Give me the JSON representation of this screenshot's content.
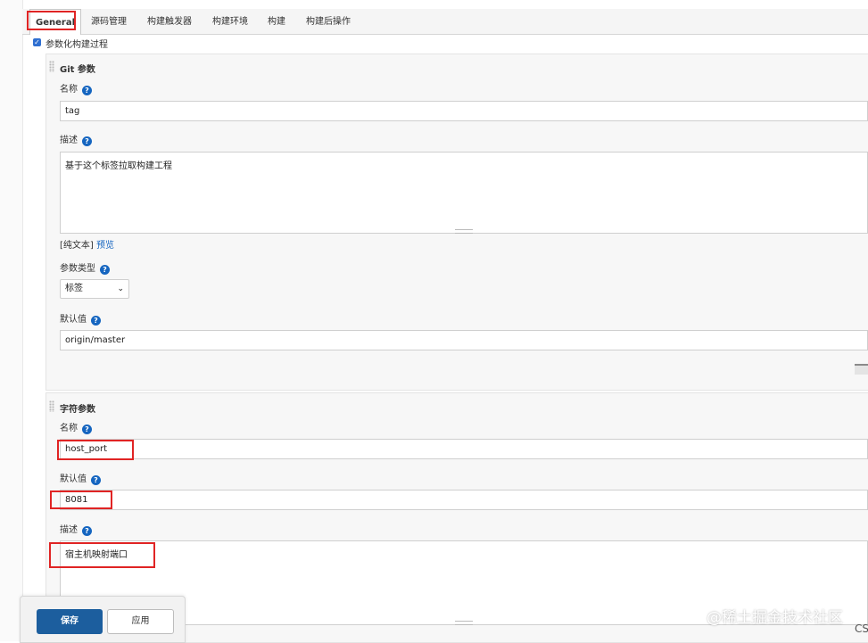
{
  "tabs": [
    {
      "label": "General"
    },
    {
      "label": "源码管理"
    },
    {
      "label": "构建触发器"
    },
    {
      "label": "构建环境"
    },
    {
      "label": "构建"
    },
    {
      "label": "构建后操作"
    }
  ],
  "parameterized_label": "参数化构建过程",
  "git_param": {
    "title": "Git 参数",
    "name_label": "名称",
    "name_value": "tag",
    "desc_label": "描述",
    "desc_value": "基于这个标签拉取构建工程",
    "format_plain": "[纯文本]",
    "format_preview": "预览",
    "type_label": "参数类型",
    "type_value": "标签",
    "default_label": "默认值",
    "default_value": "origin/master"
  },
  "string_param": {
    "title": "字符参数",
    "name_label": "名称",
    "name_value": "host_port",
    "default_label": "默认值",
    "default_value": "8081",
    "desc_label": "描述",
    "desc_value": "宿主机映射端口"
  },
  "buttons": {
    "save": "保存",
    "apply": "应用"
  },
  "watermark": "@稀土掘金技术社区",
  "corner_text": "CS"
}
